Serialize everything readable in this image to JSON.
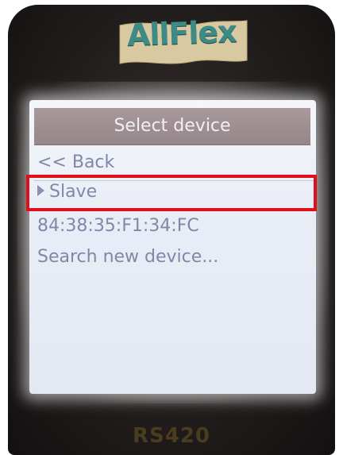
{
  "brand": {
    "logo_text": "AllFlex",
    "logo_color": "#3e8a86"
  },
  "screen": {
    "title": "Select device",
    "menu_items": [
      {
        "label": "<< Back",
        "selected": false
      },
      {
        "label": "Slave",
        "selected": true,
        "pointer_icon": "triangle-right-icon"
      },
      {
        "label": "84:38:35:F1:34:FC",
        "selected": false
      },
      {
        "label": "Search new device...",
        "selected": false
      }
    ],
    "title_bar_color": "#a89a9c",
    "text_color": "#8088a8"
  },
  "annotation": {
    "highlight_color": "#e0101a",
    "target_item": "Slave"
  },
  "device": {
    "model": "RS420"
  }
}
